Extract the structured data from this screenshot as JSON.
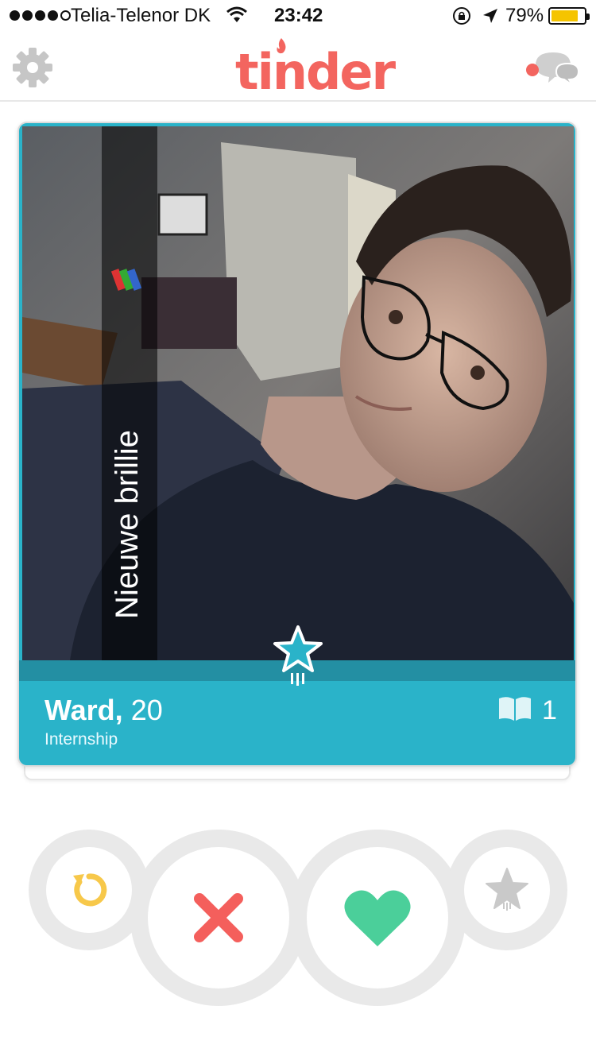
{
  "status_bar": {
    "carrier": "Telia-Telenor DK",
    "time": "23:42",
    "battery_percent": "79%",
    "battery_level": 0.79,
    "signal_bars_filled": 4,
    "signal_bars_total": 5,
    "battery_color": "#f5c400"
  },
  "nav": {
    "logo_text": "tinder",
    "logo_color": "#f3655f",
    "settings_icon": "gear-icon",
    "messages_icon": "chat-bubbles-icon"
  },
  "card": {
    "photo_caption": "Nieuwe brillie",
    "name": "Ward,",
    "age": "20",
    "job": "Internship",
    "common_interests_count": "1",
    "accent_color": "#2ab3c9",
    "badge_icon": "superlike-star-icon"
  },
  "actions": {
    "rewind": {
      "icon": "rewind-icon",
      "color": "#f7c84a"
    },
    "nope": {
      "icon": "x-icon",
      "color": "#f45f5c"
    },
    "like": {
      "icon": "heart-icon",
      "color": "#4bcf9a"
    },
    "superlike": {
      "icon": "star-icon",
      "color": "#c9c9c9"
    }
  }
}
